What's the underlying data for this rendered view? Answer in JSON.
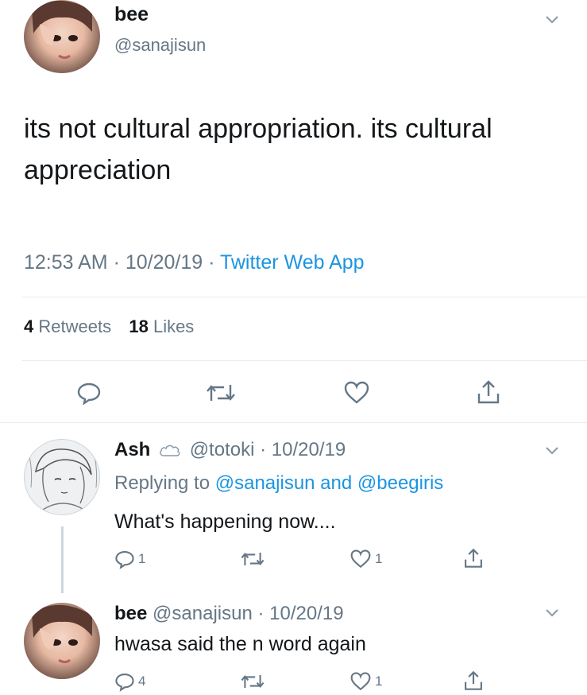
{
  "main_tweet": {
    "display_name": "bee",
    "handle": "@sanajisun",
    "text": "its not cultural appropriation. its cultural appreciation",
    "time": "12:53 AM",
    "date": "10/20/19",
    "source": "Twitter Web App",
    "retweets_count": "4",
    "retweets_label": "Retweets",
    "likes_count": "18",
    "likes_label": "Likes"
  },
  "replies": [
    {
      "display_name": "Ash",
      "handle": "@totoki",
      "date": "10/20/19",
      "replying_prefix": "Replying to",
      "replying_users": "@sanajisun and @beegiris",
      "text": "What's happening now....",
      "reply_count": "1",
      "retweet_count": "",
      "like_count": "1"
    },
    {
      "display_name": "bee",
      "handle": "@sanajisun",
      "date": "10/20/19",
      "text": "hwasa said the n word again",
      "reply_count": "4",
      "retweet_count": "",
      "like_count": "1"
    }
  ],
  "separator": "·",
  "colors": {
    "link": "#1b95e0",
    "muted": "#657786",
    "text": "#14171a",
    "divider": "#e6ecf0"
  }
}
